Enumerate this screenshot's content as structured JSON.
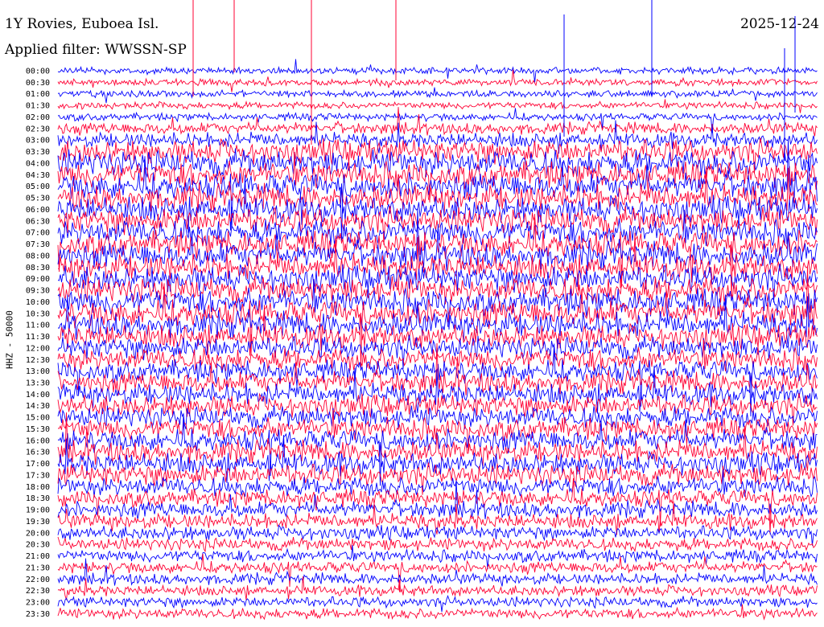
{
  "header": {
    "title": "1Y Rovies, Euboea Isl.",
    "filter": "Applied filter: WWSSN-SP",
    "date": "2025-12-24"
  },
  "chart_data": {
    "type": "line",
    "title": "1Y Rovies, Euboea Isl.",
    "ylabel": "HHZ - 50000",
    "xlabel": "",
    "row_labels": [
      "00:00",
      "00:30",
      "01:00",
      "01:30",
      "02:00",
      "02:30",
      "03:00",
      "03:30",
      "04:00",
      "04:30",
      "05:00",
      "05:30",
      "06:00",
      "06:30",
      "07:00",
      "07:30",
      "08:00",
      "08:30",
      "09:00",
      "09:30",
      "10:00",
      "10:30",
      "11:00",
      "11:30",
      "12:00",
      "12:30",
      "13:00",
      "13:30",
      "14:00",
      "14:30",
      "15:00",
      "15:30",
      "16:00",
      "16:30",
      "17:00",
      "17:30",
      "18:00",
      "18:30",
      "19:00",
      "19:30",
      "20:00",
      "20:30",
      "21:00",
      "21:30",
      "22:00",
      "22:30",
      "23:00",
      "23:30"
    ],
    "colors": [
      "#0000ff",
      "#ff0033"
    ],
    "trace_amplitude_levels": [
      0.12,
      0.12,
      0.12,
      0.14,
      0.16,
      0.35,
      0.5,
      0.9,
      1.0,
      1.0,
      1.0,
      1.0,
      1.0,
      1.0,
      1.0,
      1.0,
      1.0,
      1.0,
      1.0,
      1.0,
      1.0,
      1.0,
      0.95,
      0.9,
      0.85,
      0.85,
      0.8,
      0.8,
      0.8,
      0.8,
      0.8,
      0.8,
      0.8,
      0.8,
      0.8,
      0.8,
      0.7,
      0.6,
      0.55,
      0.5,
      0.45,
      0.4,
      0.38,
      0.35,
      0.33,
      0.3,
      0.3,
      0.3
    ]
  }
}
